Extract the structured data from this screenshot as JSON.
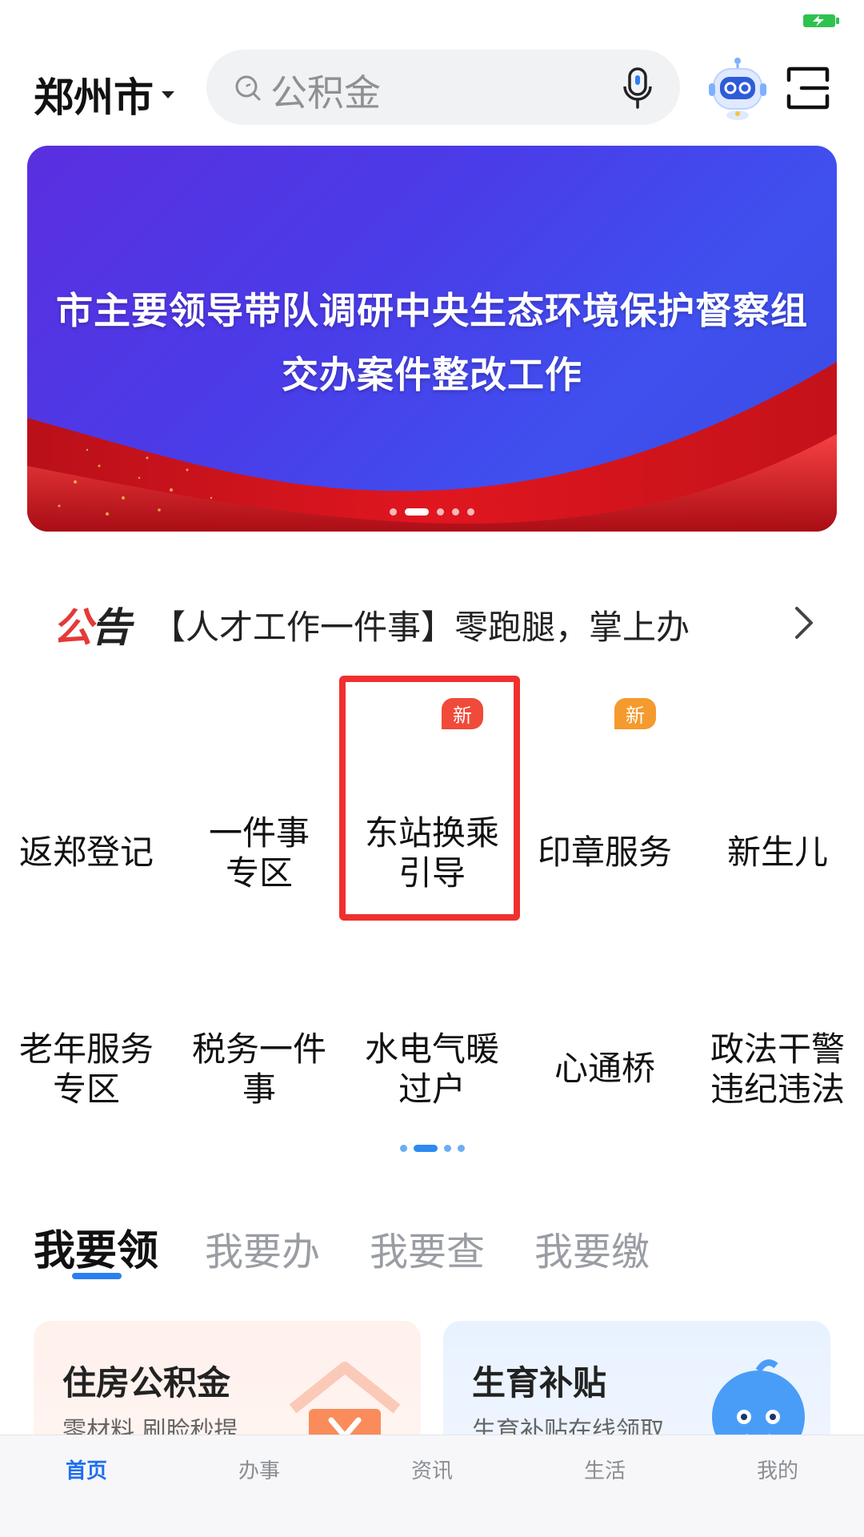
{
  "header": {
    "city": "郑州市",
    "search_placeholder": "公积金"
  },
  "banner": {
    "line1": "市主要领导带队调研中央生态环境保护督察组",
    "line2": "交办案件整改工作",
    "page_count": 5,
    "active_page": 2
  },
  "notice": {
    "tag_left": "公",
    "tag_right": "告",
    "text": "【人才工作一件事】零跑腿，掌上办"
  },
  "services": [
    {
      "label_1": "返郑登记",
      "label_2": "",
      "icon": "notebook-pen-icon",
      "badge": ""
    },
    {
      "label_1": "一件事",
      "label_2": "专区",
      "icon": "stacked-squares-icon",
      "badge": ""
    },
    {
      "label_1": "东站换乘",
      "label_2": "引导",
      "icon": "route-icon",
      "badge": "新"
    },
    {
      "label_1": "印章服务",
      "label_2": "",
      "icon": "stamp-icon",
      "badge": "新"
    },
    {
      "label_1": "新生儿",
      "label_2": "",
      "icon": "baby-face-icon",
      "badge": ""
    },
    {
      "label_1": "老年服务",
      "label_2": "专区",
      "icon": "elder-heart-icon",
      "badge": ""
    },
    {
      "label_1": "税务一件",
      "label_2": "事",
      "icon": "tax-character-icon",
      "badge": ""
    },
    {
      "label_1": "水电气暖",
      "label_2": "过户",
      "icon": "flame-transfer-icon",
      "badge": ""
    },
    {
      "label_1": "心通桥",
      "label_2": "",
      "icon": "heart-bridge-icon",
      "badge": ""
    },
    {
      "label_1": "政法干警",
      "label_2": "违纪违法",
      "icon": "alarm-light-icon",
      "badge": ""
    }
  ],
  "tabs": [
    "我要领",
    "我要办",
    "我要查",
    "我要缴"
  ],
  "active_tab": 0,
  "cards": [
    {
      "title": "住房公积金",
      "subtitle": "零材料 刷脸秒提"
    },
    {
      "title": "生育补贴",
      "subtitle": "生育补贴在线领取"
    }
  ],
  "nav": [
    "首页",
    "办事",
    "资讯",
    "生活",
    "我的"
  ],
  "active_nav": 0,
  "colors": {
    "accent": "#1f6ff0",
    "highlight_border": "#f03030",
    "badge_red": "#f04a3a",
    "badge_orange": "#f59a2e"
  }
}
